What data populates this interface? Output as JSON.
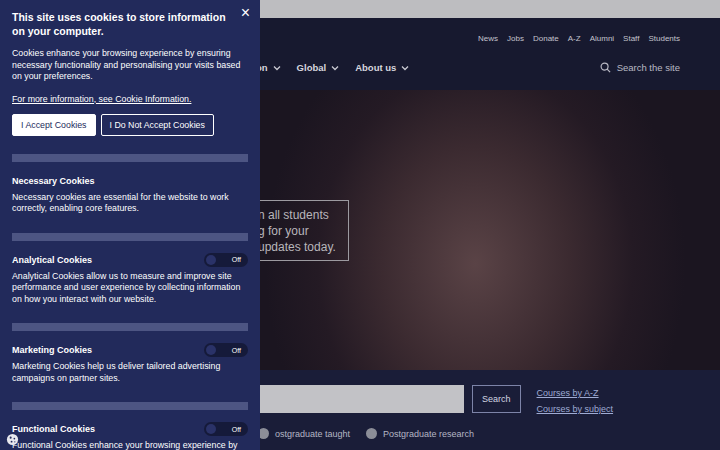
{
  "topbar": {
    "links": [
      "News",
      "Jobs",
      "Donate",
      "A-Z",
      "Alumni",
      "Staff",
      "Students"
    ]
  },
  "nav": {
    "items": [
      "on",
      "Global",
      "About us"
    ],
    "search": {
      "placeholder": "Search the site"
    }
  },
  "hero": {
    "lines": [
      "n all students",
      "g for your",
      "updates today."
    ]
  },
  "course_search": {
    "button": "Search",
    "links": [
      "Courses by A-Z",
      "Courses by subject"
    ],
    "options": [
      {
        "label": "ostgraduate taught",
        "selected": false
      },
      {
        "label": "Postgraduate research",
        "selected": false
      }
    ]
  },
  "cookie_panel": {
    "close": "×",
    "title": "This site uses cookies to store information on your computer.",
    "intro": "Cookies enhance your browsing experience by ensuring necessary functionality and personalising your visits based on your preferences.",
    "link": "For more information, see Cookie Information.",
    "buttons": [
      "I Accept Cookies",
      "I Do Not Accept Cookies"
    ],
    "categories": [
      {
        "name": "Necessary Cookies",
        "kind": "info",
        "description": "Necessary cookies are essential for the website to work correctly, enabling core features."
      },
      {
        "name": "Analytical Cookies",
        "kind": "toggle",
        "on": false,
        "toggle_label": "Off",
        "description": "Analytical Cookies allow us to measure and improve site performance and user experience by collecting information on how you interact with our website."
      },
      {
        "name": "Marketing Cookies",
        "kind": "toggle",
        "on": false,
        "toggle_label": "Off",
        "description": "Marketing Cookies help us deliver tailored advertising campaigns on partner sites."
      },
      {
        "name": "Functional Cookies",
        "kind": "toggle",
        "on": false,
        "toggle_label": "Off",
        "description": "Functional Cookies enhance your browsing experience by"
      }
    ]
  }
}
